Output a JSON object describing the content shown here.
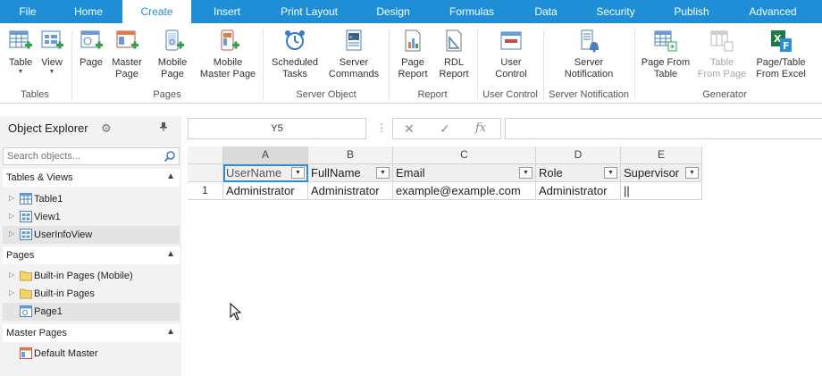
{
  "menu": {
    "tabs": [
      {
        "label": "File"
      },
      {
        "label": "Home"
      },
      {
        "label": "Create"
      },
      {
        "label": "Insert"
      },
      {
        "label": "Print Layout"
      },
      {
        "label": "Design"
      },
      {
        "label": "Formulas"
      },
      {
        "label": "Data"
      },
      {
        "label": "Security"
      },
      {
        "label": "Publish"
      },
      {
        "label": "Advanced"
      }
    ],
    "active": "Create"
  },
  "ribbon": {
    "groups": [
      {
        "label": "Tables"
      },
      {
        "label": "Pages"
      },
      {
        "label": "Server Object"
      },
      {
        "label": "Report"
      },
      {
        "label": "User Control"
      },
      {
        "label": "Server Notification"
      },
      {
        "label": "Generator"
      }
    ],
    "buttons": [
      {
        "line1": "Table",
        "line2": ""
      },
      {
        "line1": "View",
        "line2": ""
      },
      {
        "line1": "Page",
        "line2": ""
      },
      {
        "line1": "Master",
        "line2": "Page"
      },
      {
        "line1": "Mobile",
        "line2": "Page"
      },
      {
        "line1": "Mobile",
        "line2": "Master Page"
      },
      {
        "line1": "Scheduled",
        "line2": "Tasks"
      },
      {
        "line1": "Server",
        "line2": "Commands"
      },
      {
        "line1": "Page",
        "line2": "Report"
      },
      {
        "line1": "RDL",
        "line2": "Report"
      },
      {
        "line1": "User",
        "line2": "Control"
      },
      {
        "line1": "Server",
        "line2": "Notification"
      },
      {
        "line1": "Page From",
        "line2": "Table"
      },
      {
        "line1": "Table",
        "line2": "From Page"
      },
      {
        "line1": "Page/Table",
        "line2": "From Excel"
      }
    ]
  },
  "explorer": {
    "title": "Object Explorer",
    "search_placeholder": "Search objects...",
    "sections": [
      {
        "title": "Tables & Views",
        "items": [
          {
            "label": "Table1",
            "icon": "table-icon"
          },
          {
            "label": "View1",
            "icon": "view-icon"
          },
          {
            "label": "UserInfoView",
            "icon": "view-icon"
          }
        ]
      },
      {
        "title": "Pages",
        "items": [
          {
            "label": "Built-in Pages (Mobile)",
            "icon": "folder-icon"
          },
          {
            "label": "Built-in Pages",
            "icon": "folder-icon"
          },
          {
            "label": "Page1",
            "icon": "page-icon"
          }
        ]
      },
      {
        "title": "Master Pages",
        "items": [
          {
            "label": "Default Master",
            "icon": "master-page-icon"
          }
        ]
      }
    ]
  },
  "formula_bar": {
    "cell_ref": "Y5",
    "dots": "⋮",
    "cancel": "✕",
    "confirm": "✓",
    "fx": "fx",
    "formula": ""
  },
  "grid": {
    "columns": [
      "A",
      "B",
      "C",
      "D",
      "E"
    ],
    "selected_column": "A",
    "header_row": [
      "UserName",
      "FullName",
      "Email",
      "Role",
      "Supervisor"
    ],
    "rows": [
      {
        "num": "1",
        "cells": [
          "Administrator",
          "Administrator",
          "example@example.com",
          "Administrator",
          "||"
        ]
      }
    ]
  }
}
